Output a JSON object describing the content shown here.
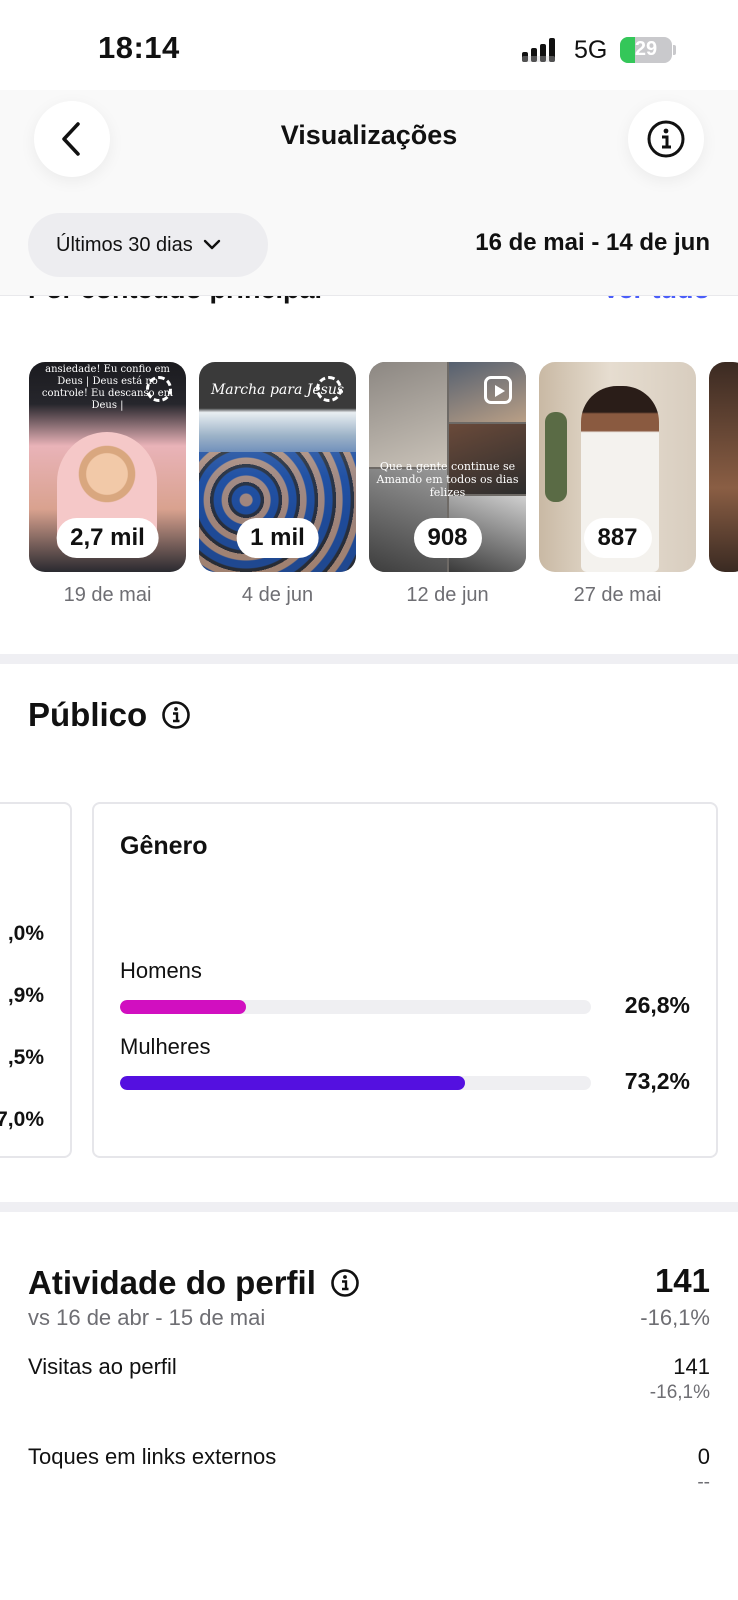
{
  "status_bar": {
    "time": "18:14",
    "network": "5G",
    "battery": "29",
    "battery_level": 0.29,
    "signal_icon": "cellular-signal-icon",
    "charging_icon": "bolt-icon"
  },
  "header": {
    "title": "Visualizações",
    "back_icon": "chevron-left-icon",
    "info_icon": "info-icon",
    "range_label": "Últimos 30 dias",
    "range_icon": "chevron-down-icon",
    "date_range": "16 de mai - 14 de jun"
  },
  "top_content": {
    "heading": "Por conteúdo principal",
    "see_all": "Ver tudo",
    "items": [
      {
        "views": "2,7 mil",
        "date": "19 de mai",
        "type_icon": "story-ring-icon",
        "caption": "ansiedade! Eu confio em Deus | Deus está no controle! Eu descanso em Deus |"
      },
      {
        "views": "1 mil",
        "date": "4 de jun",
        "type_icon": "story-ring-icon",
        "caption": "Marcha para Jesus"
      },
      {
        "views": "908",
        "date": "12 de jun",
        "type_icon": "reel-icon",
        "caption": "Que a gente continue se Amando em todos os dias felizes"
      },
      {
        "views": "887",
        "date": "27 de mai",
        "type_icon": "none",
        "caption": ""
      }
    ]
  },
  "audience": {
    "title": "Público",
    "info_icon": "info-icon",
    "prev_card_values": [
      ",0%",
      ",9%",
      ",5%",
      "7,0%"
    ],
    "gender": {
      "title": "Gênero",
      "rows": [
        {
          "label": "Homens",
          "percent": "26,8%",
          "value": 26.8,
          "color": "#d10fc0"
        },
        {
          "label": "Mulheres",
          "percent": "73,2%",
          "value": 73.2,
          "color": "#5410e0"
        }
      ]
    }
  },
  "profile_activity": {
    "title": "Atividade do perfil",
    "info_icon": "info-icon",
    "compare": "vs 16 de abr - 15 de mai",
    "total": "141",
    "total_change": "-16,1%",
    "rows": [
      {
        "label": "Visitas ao perfil",
        "value": "141",
        "change": "-16,1%"
      },
      {
        "label": "Toques em links externos",
        "value": "0",
        "change": "--"
      }
    ]
  }
}
